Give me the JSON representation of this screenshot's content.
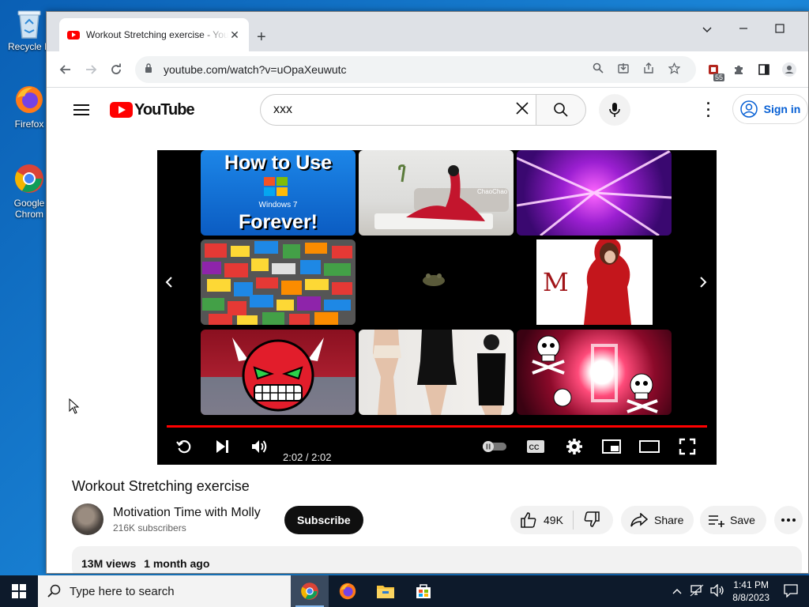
{
  "desktop": {
    "icons": [
      {
        "label": "Recycle Bin",
        "short": "Recycle B"
      },
      {
        "label": "Firefox",
        "short": "Firefox"
      },
      {
        "label": "Google Chrome",
        "short1": "Google",
        "short2": "Chrom"
      }
    ]
  },
  "browser": {
    "tab_title": "Workout Stretching exercise - YouTube",
    "url": "youtube.com/watch?v=uOpaXeuwutc",
    "ext_badge": "55"
  },
  "youtube": {
    "logo_text": "YouTube",
    "search_value": "xxx",
    "sign_in": "Sign in",
    "player": {
      "time": "2:02 / 2:02",
      "progress": 1.0
    },
    "thumbs": {
      "win7_line1": "How to Use",
      "win7_mid": "Windows 7",
      "win7_line2": "Forever!",
      "yoga_caption": "ChaoChao"
    },
    "video_title": "Workout Stretching exercise",
    "channel_name": "Motivation Time with Molly",
    "subscribers": "216K subscribers",
    "subscribe_label": "Subscribe",
    "likes": "49K",
    "share_label": "Share",
    "save_label": "Save",
    "views": "13M views",
    "age": "1 month ago"
  },
  "taskbar": {
    "search_placeholder": "Type here to search",
    "time": "1:41 PM",
    "date": "8/8/2023"
  }
}
